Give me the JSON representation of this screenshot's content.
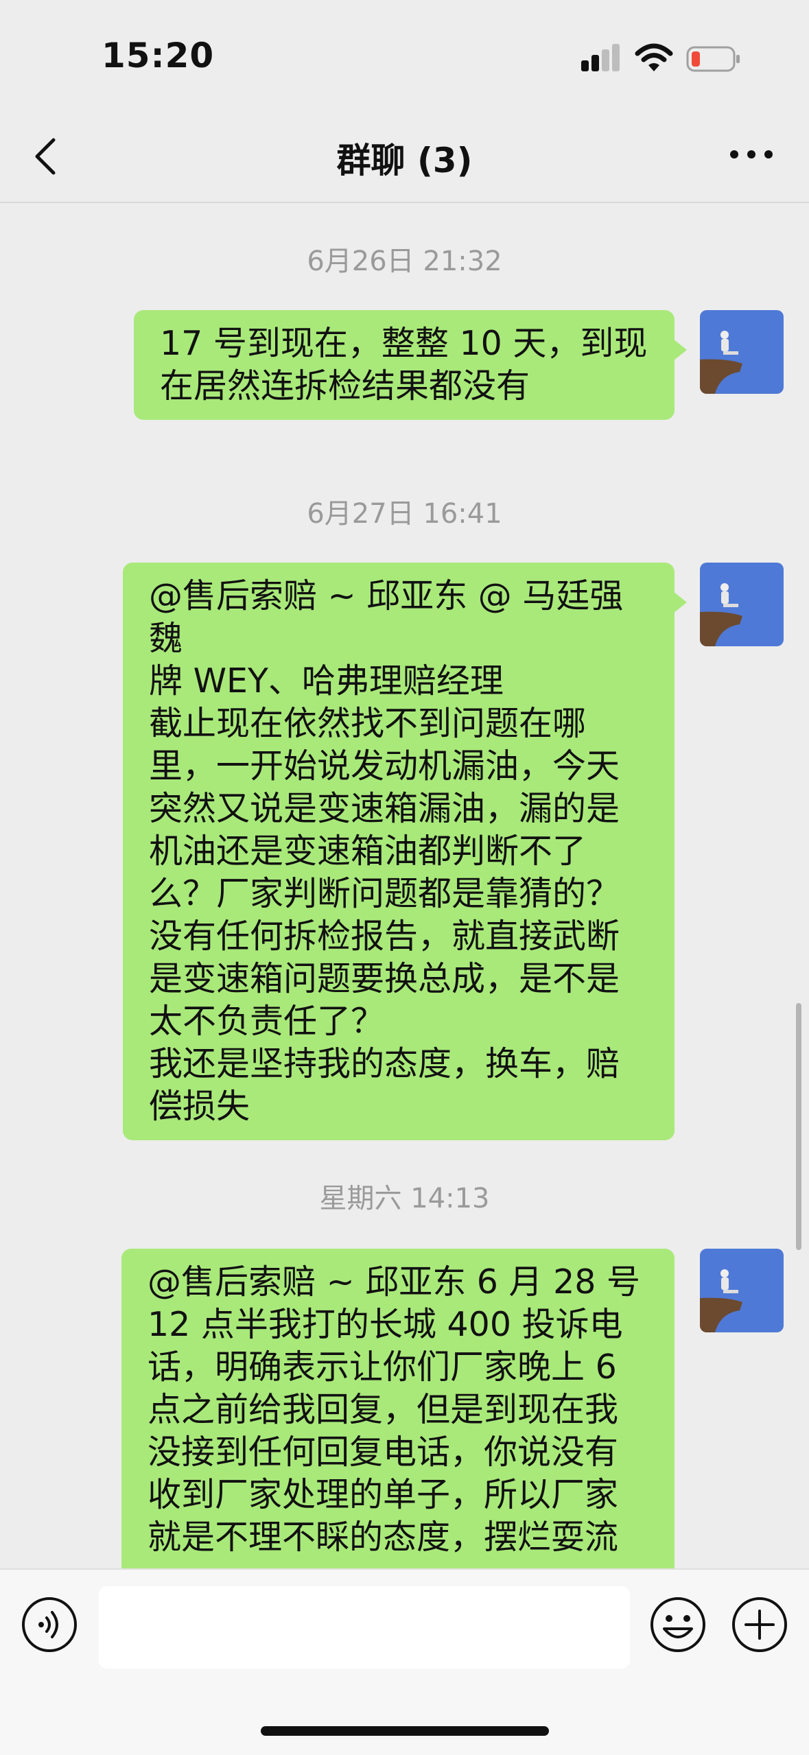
{
  "status_bar": {
    "time": "15:20"
  },
  "nav": {
    "title": "群聊 (3)"
  },
  "timestamps": [
    "6月26日 21:32",
    "6月27日 16:41",
    "星期六 14:13"
  ],
  "messages": [
    {
      "text": "17 号到现在，整整 10 天，到现\n在居然连拆检结果都没有"
    },
    {
      "text": "@售后索赔 ~ 邱亚东 @ 马廷强魏\n牌 WEY、哈弗理赔经理\n截止现在依然找不到问题在哪\n里，一开始说发动机漏油，今天\n突然又说是变速箱漏油，漏的是\n机油还是变速箱油都判断不了\n么？厂家判断问题都是靠猜的？\n没有任何拆检报告，就直接武断\n是变速箱问题要换总成，是不是\n太不负责任了？\n我还是坚持我的态度，换车，赔\n偿损失"
    },
    {
      "text": "@售后索赔 ~ 邱亚东 6 月 28 号\n12 点半我打的长城 400 投诉电\n话，明确表示让你们厂家晚上 6\n点之前给我回复，但是到现在我\n没接到任何回复电话，你说没有\n收到厂家处理的单子，所以厂家\n就是不理不睬的态度，摆烂耍流"
    }
  ],
  "input": {
    "placeholder": ""
  },
  "colors": {
    "bubble": "#a9e97a",
    "background": "#ededed",
    "battery_low": "#f04b3a"
  },
  "icons": [
    "back-arrow-icon",
    "more-icon",
    "voice-icon",
    "emoji-icon",
    "plus-icon",
    "signal-icon",
    "wifi-icon",
    "battery-icon"
  ]
}
